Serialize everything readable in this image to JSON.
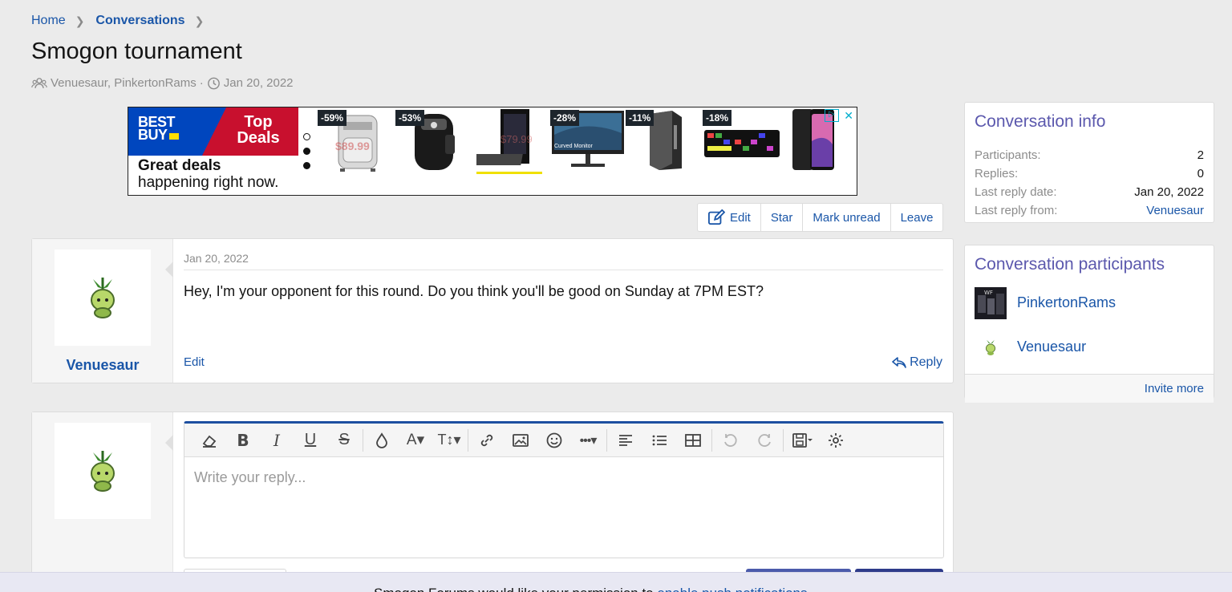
{
  "breadcrumb": {
    "home": "Home",
    "conversations": "Conversations"
  },
  "page": {
    "title": "Smogon tournament",
    "participants_meta": "Venuesaur, PinkertonRams",
    "date_meta": "Jan 20, 2022"
  },
  "ad": {
    "brand": "BEST BUY",
    "top_deals": "Top Deals",
    "headline": "Great deals",
    "subline": "happening right now.",
    "discounts": [
      "-59%",
      "-53%",
      "-28%",
      "-11%",
      "-18%"
    ],
    "price_ghost1": "$89.99",
    "price_ghost2": "$79.99",
    "monitor_label": "Curved Monitor"
  },
  "actions": {
    "edit": "Edit",
    "star": "Star",
    "mark_unread": "Mark unread",
    "leave": "Leave"
  },
  "message": {
    "date": "Jan 20, 2022",
    "body": "Hey, I'm your opponent for this round. Do you think you'll be good on Sunday at 7PM EST?",
    "username": "Venuesaur",
    "edit": "Edit",
    "reply": "Reply"
  },
  "editor": {
    "placeholder": "Write your reply..."
  },
  "conversation_info": {
    "title": "Conversation info",
    "rows": [
      {
        "key": "Participants:",
        "value": "2"
      },
      {
        "key": "Replies:",
        "value": "0"
      },
      {
        "key": "Last reply date:",
        "value": "Jan 20, 2022"
      },
      {
        "key": "Last reply from:",
        "value": "Venuesaur"
      }
    ]
  },
  "participants": {
    "title": "Conversation participants",
    "items": [
      "PinkertonRams",
      "Venuesaur"
    ],
    "invite_more": "Invite more"
  },
  "notice": {
    "text": "Smogon Forums would like your permission to ",
    "link": "enable push notifications"
  },
  "colors": {
    "link": "#1a56a8",
    "sidebar_title": "#5b58ad",
    "editor_accent": "#1d4fa0",
    "bestbuy_blue": "#0046be",
    "bestbuy_red": "#c8102e"
  }
}
